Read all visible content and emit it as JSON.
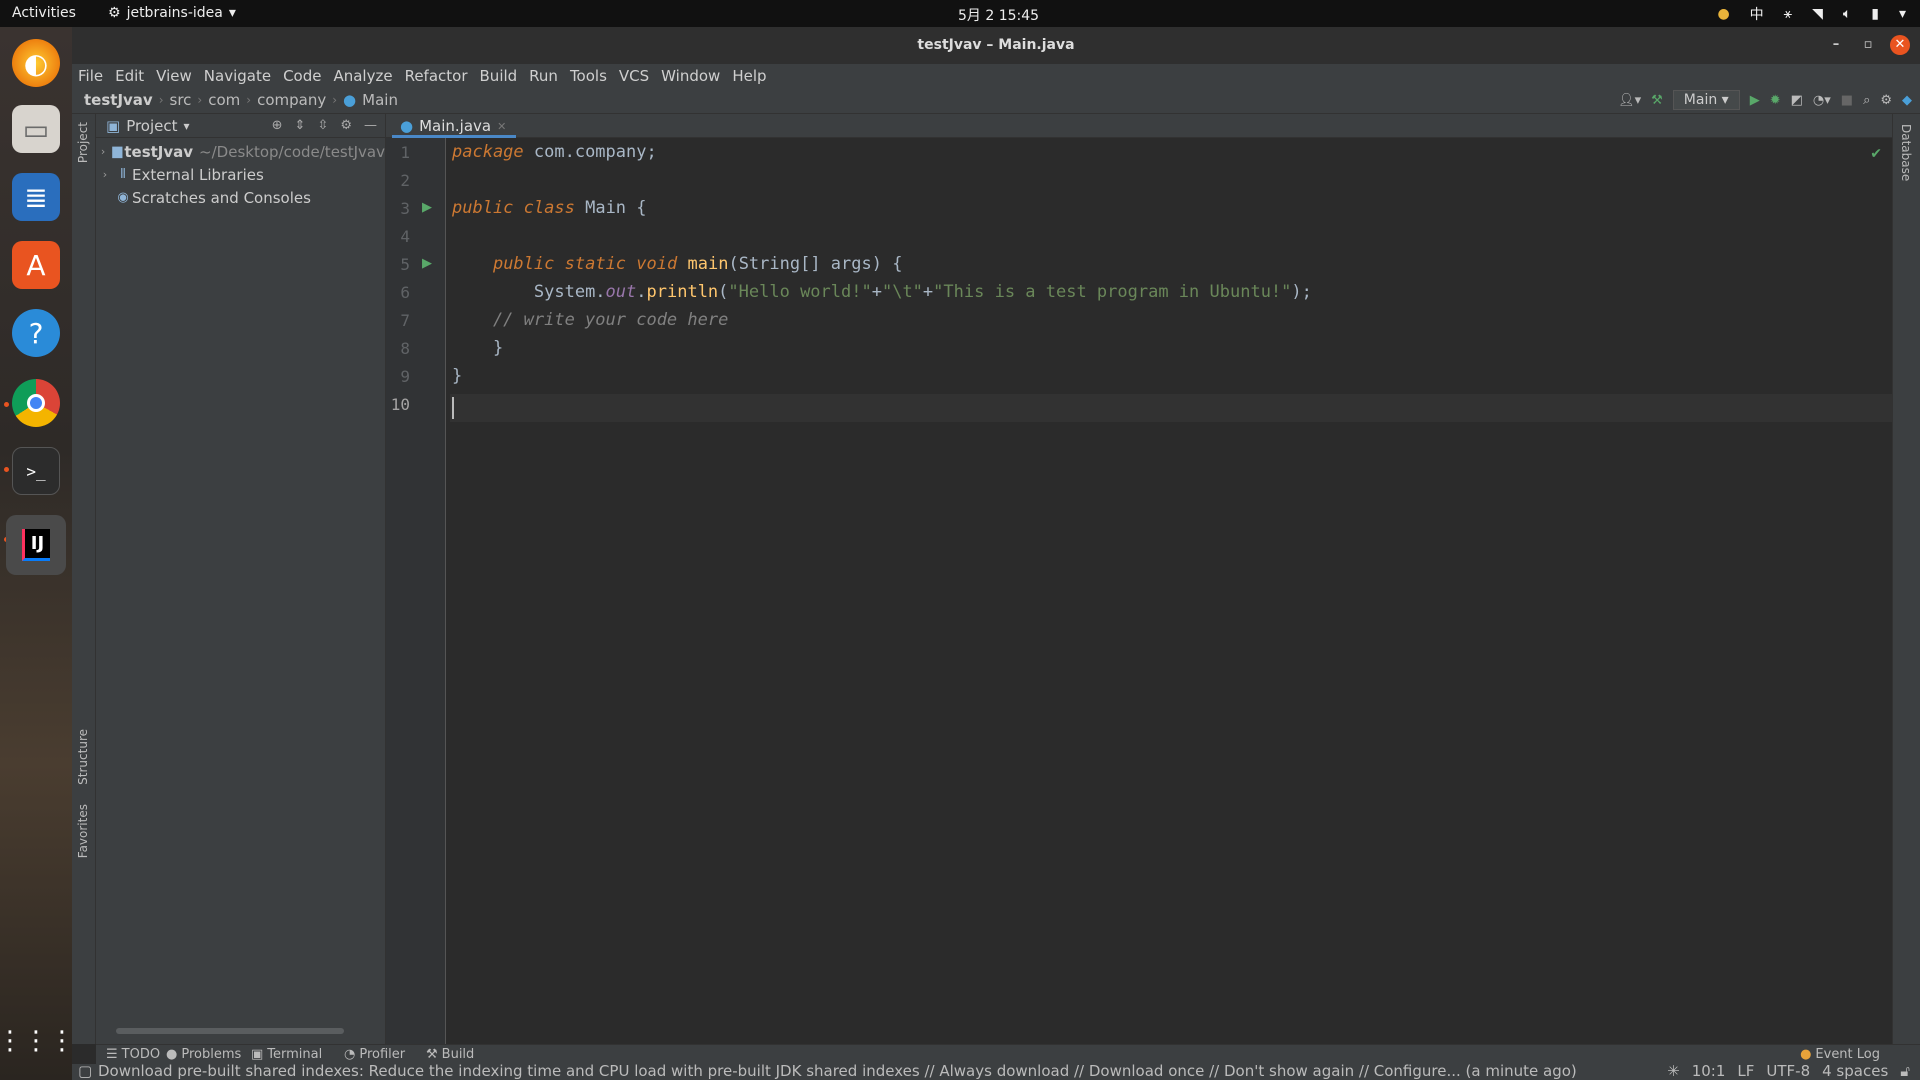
{
  "topbar": {
    "activities": "Activities",
    "app_name": "jetbrains-idea",
    "clock": "5月 2  15:45",
    "input_method": "中"
  },
  "window": {
    "title": "testJvav – Main.java"
  },
  "menu": [
    "File",
    "Edit",
    "View",
    "Navigate",
    "Code",
    "Analyze",
    "Refactor",
    "Build",
    "Run",
    "Tools",
    "VCS",
    "Window",
    "Help"
  ],
  "breadcrumb": [
    "testJvav",
    "src",
    "com",
    "company",
    "Main"
  ],
  "run_config": "Main",
  "project_panel": {
    "title": "Project",
    "tree": [
      {
        "label": "testJvav",
        "path": "~/Desktop/code/testJvav"
      },
      {
        "label": "External Libraries"
      },
      {
        "label": "Scratches and Consoles"
      }
    ]
  },
  "left_stripe": {
    "project": "Project",
    "structure": "Structure",
    "favorites": "Favorites"
  },
  "right_stripe": {
    "database": "Database"
  },
  "editor": {
    "tab": "Main.java",
    "line_numbers": [
      "1",
      "2",
      "3",
      "4",
      "5",
      "6",
      "7",
      "8",
      "9",
      "10"
    ],
    "code": {
      "l1_kw": "package",
      "l1_rest": " com.company;",
      "l3_kw1": "public",
      "l3_kw2": "class",
      "l3_rest": " Main {",
      "l5_indent": "    ",
      "l5_kw1": "public",
      "l5_kw2": "static",
      "l5_kw3": "void",
      "l5_fn": "main",
      "l5_rest": "(String[] args) {",
      "l6_indent": "        ",
      "l6_cls": "System.",
      "l6_fld": "out",
      "l6_dot": ".",
      "l6_fn": "println",
      "l6_open": "(",
      "l6_s1": "\"Hello world!\"",
      "l6_p1": "+",
      "l6_s2": "\"\\t\"",
      "l6_p2": "+",
      "l6_s3": "\"This is a test program in Ubuntu!\"",
      "l6_close": ");",
      "l7": "    // write your code here",
      "l8": "    }",
      "l9": "}"
    }
  },
  "bottom_tools": [
    "TODO",
    "Problems",
    "Terminal",
    "Profiler",
    "Build"
  ],
  "event_log": "Event Log",
  "status": {
    "message": "Download pre-built shared indexes: Reduce the indexing time and CPU load with pre-built JDK shared indexes // Always download // Download once // Don't show again // Configure... (a minute ago)",
    "position": "10:1",
    "line_sep": "LF",
    "encoding": "UTF-8",
    "indent": "4 spaces"
  },
  "colors": {
    "keyword": "#cc7832",
    "string": "#6a8759",
    "function": "#ffc66d",
    "field": "#9876aa",
    "accent": "#4a88c7"
  }
}
